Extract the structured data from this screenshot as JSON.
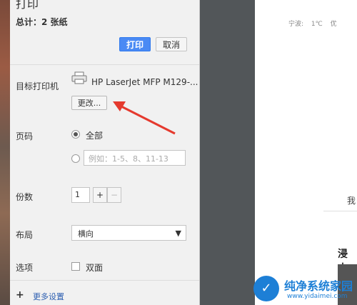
{
  "panel": {
    "title": "打印",
    "total": "总计：2 张纸",
    "print_label": "打印",
    "cancel_label": "取消"
  },
  "destination": {
    "label": "目标打印机",
    "printer_name": "HP LaserJet MFP M129-...",
    "change_label": "更改..."
  },
  "pages": {
    "label": "页码",
    "all_label": "全部",
    "range_placeholder": "例如：1-5、8、11-13"
  },
  "copies": {
    "label": "份数",
    "value": "1",
    "plus": "+",
    "minus": "−"
  },
  "layout": {
    "label": "布局",
    "selected": "横向"
  },
  "options": {
    "label": "选项",
    "duplex_label": "双面"
  },
  "more_settings": "更多设置",
  "preview": {
    "weather_city": "宁波:",
    "weather_temp": "1℃",
    "weather_extra": "优",
    "text_1": "我",
    "text_2": "浸大"
  },
  "watermark": {
    "name": "纯净系统家园",
    "url": "www.yidaimei.com"
  },
  "colors": {
    "accent": "#4a8af4",
    "arrow": "#e53a2e",
    "backdrop": "#525659"
  }
}
